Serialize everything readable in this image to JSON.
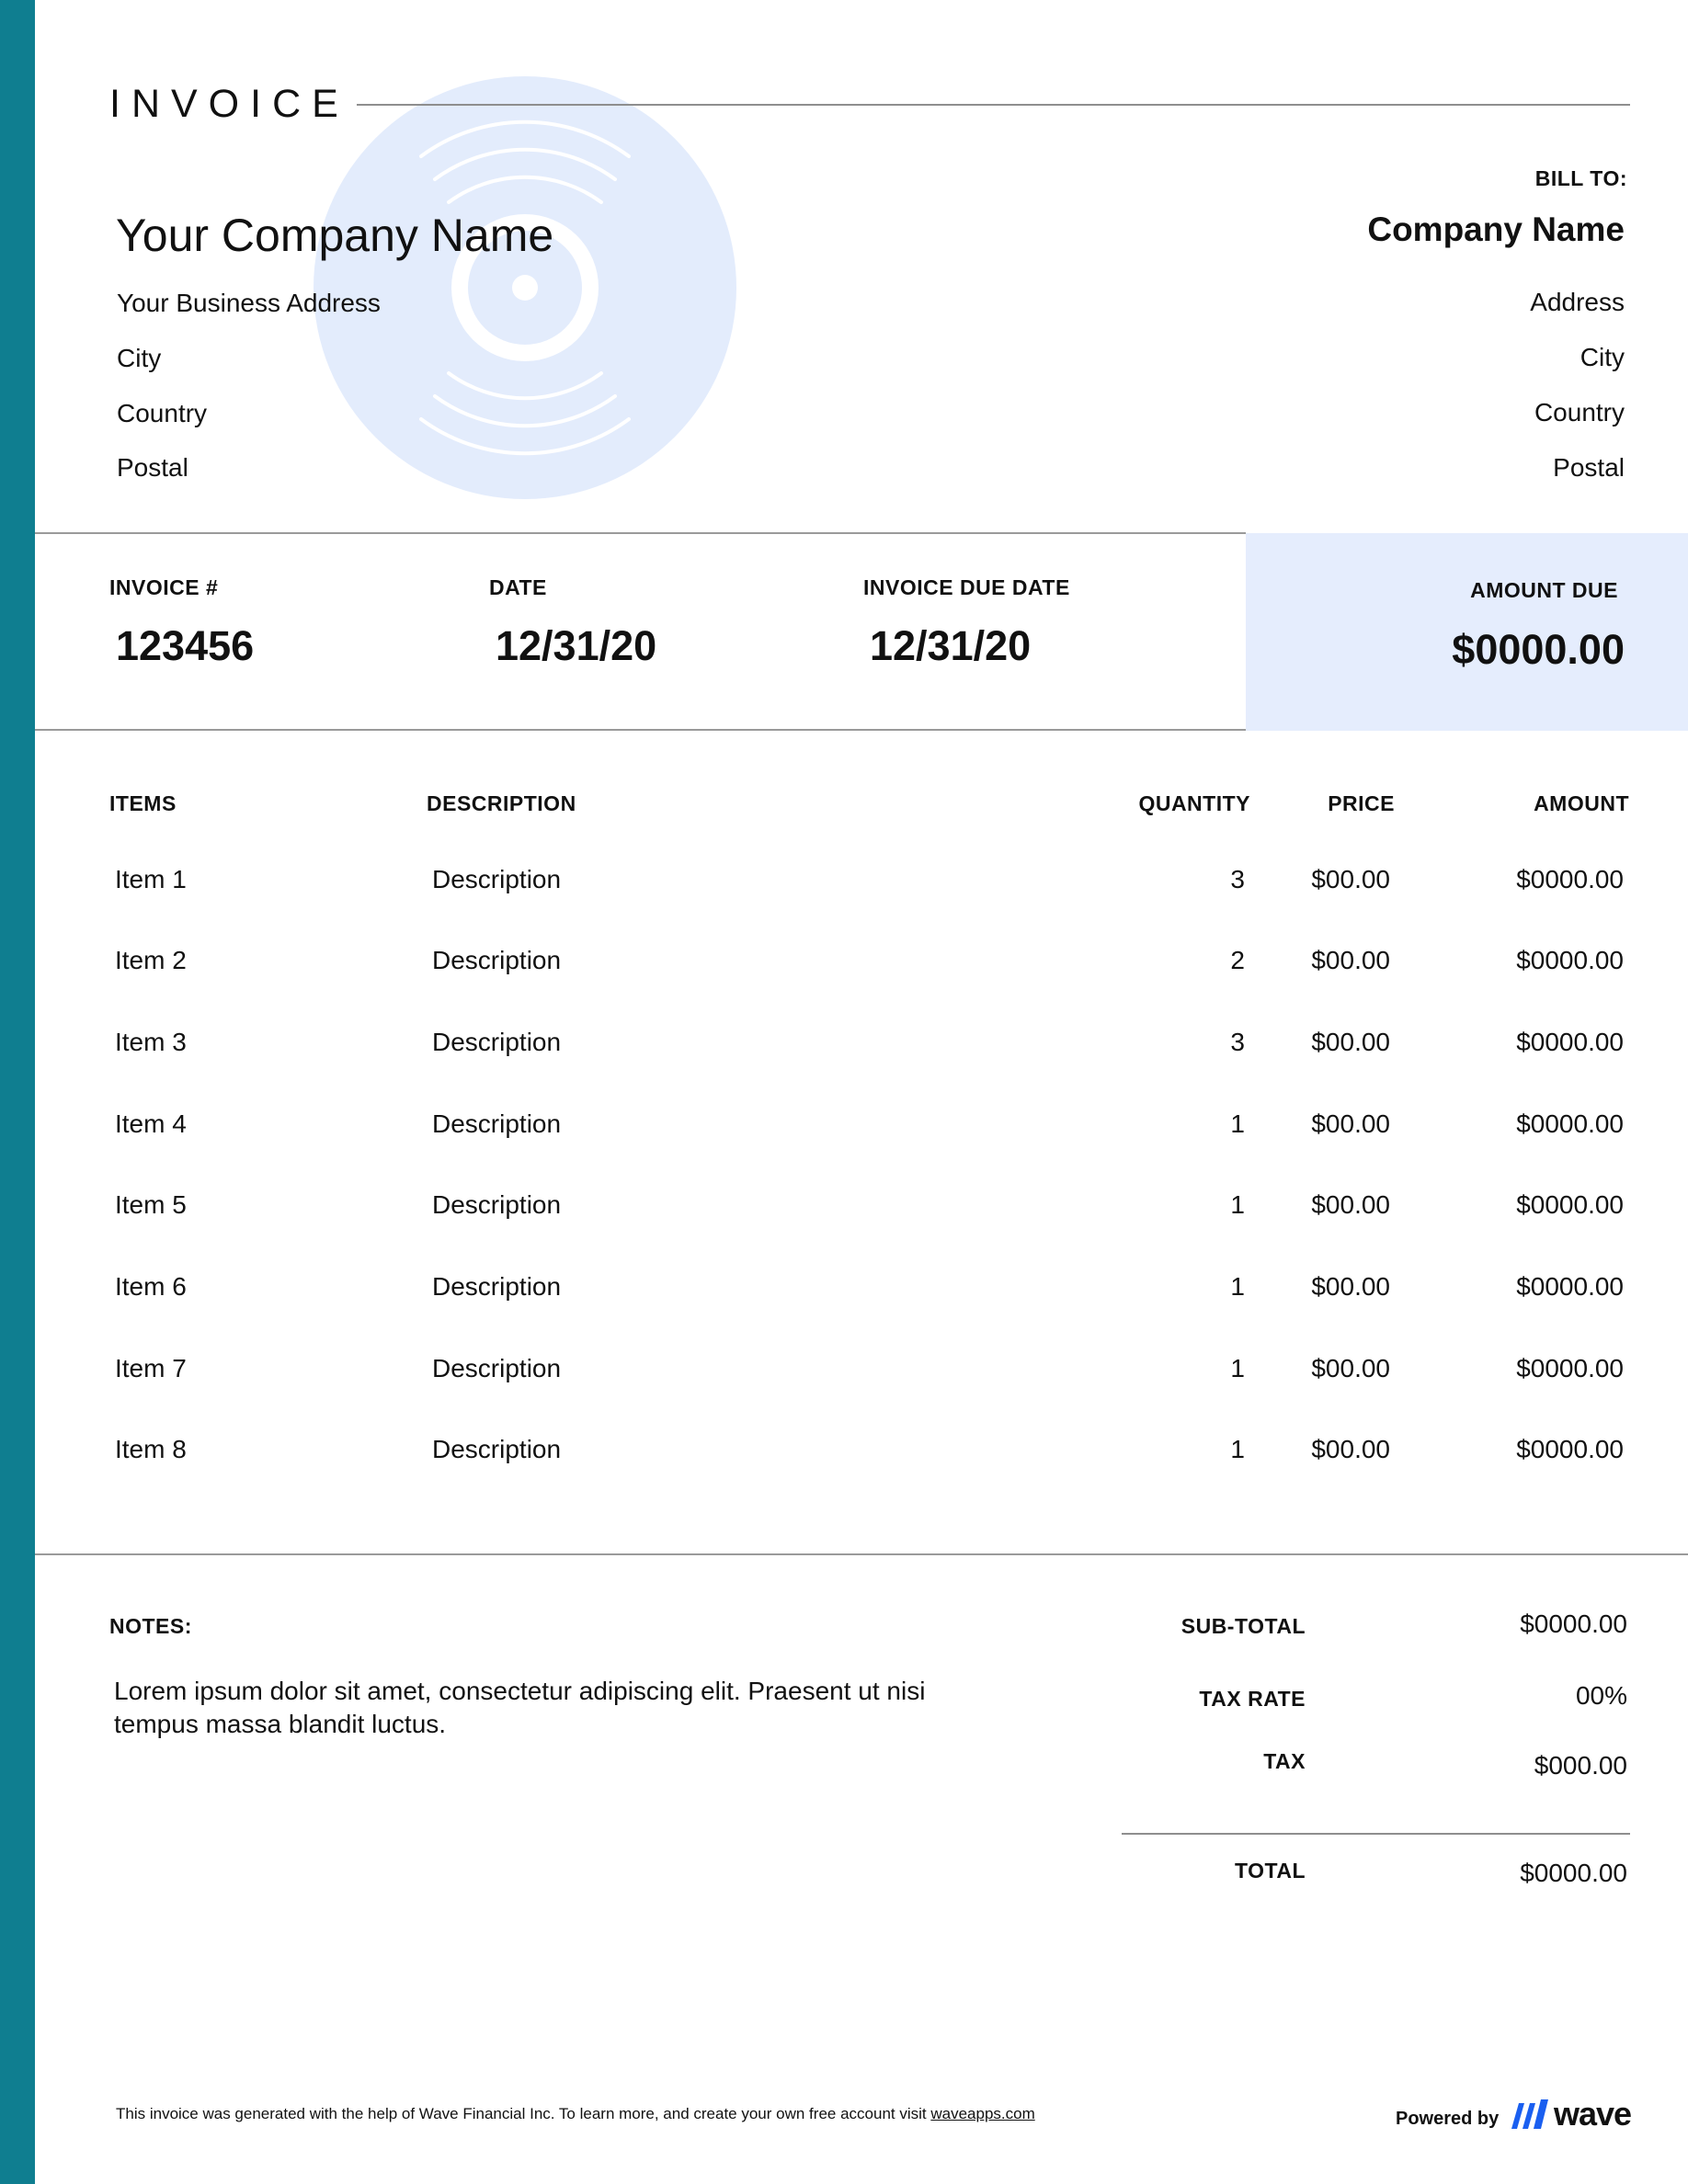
{
  "header": {
    "title": "INVOICE"
  },
  "from": {
    "company": "Your Company Name",
    "lines": [
      "Your Business Address",
      "City",
      "Country",
      "Postal"
    ]
  },
  "bill_to": {
    "label": "BILL TO:",
    "company": "Company Name",
    "lines": [
      "Address",
      "City",
      "Country",
      "Postal"
    ]
  },
  "meta": {
    "invoice_number_label": "INVOICE #",
    "invoice_number": "123456",
    "date_label": "DATE",
    "date": "12/31/20",
    "due_date_label": "INVOICE DUE DATE",
    "due_date": "12/31/20",
    "amount_due_label": "AMOUNT DUE",
    "amount_due": "$0000.00"
  },
  "table": {
    "headers": [
      "ITEMS",
      "DESCRIPTION",
      "QUANTITY",
      "PRICE",
      "AMOUNT"
    ],
    "rows": [
      {
        "item": "Item 1",
        "description": "Description",
        "quantity": "3",
        "price": "$00.00",
        "amount": "$0000.00"
      },
      {
        "item": "Item 2",
        "description": "Description",
        "quantity": "2",
        "price": "$00.00",
        "amount": "$0000.00"
      },
      {
        "item": "Item 3",
        "description": "Description",
        "quantity": "3",
        "price": "$00.00",
        "amount": "$0000.00"
      },
      {
        "item": "Item 4",
        "description": "Description",
        "quantity": "1",
        "price": "$00.00",
        "amount": "$0000.00"
      },
      {
        "item": "Item 5",
        "description": "Description",
        "quantity": "1",
        "price": "$00.00",
        "amount": "$0000.00"
      },
      {
        "item": "Item 6",
        "description": "Description",
        "quantity": "1",
        "price": "$00.00",
        "amount": "$0000.00"
      },
      {
        "item": "Item 7",
        "description": "Description",
        "quantity": "1",
        "price": "$00.00",
        "amount": "$0000.00"
      },
      {
        "item": "Item 8",
        "description": "Description",
        "quantity": "1",
        "price": "$00.00",
        "amount": "$0000.00"
      }
    ]
  },
  "notes": {
    "label": "NOTES:",
    "text": "Lorem ipsum dolor sit amet, consectetur adipiscing elit. Praesent ut nisi tempus massa blandit luctus."
  },
  "totals": {
    "subtotal_label": "SUB-TOTAL",
    "subtotal": "$0000.00",
    "tax_rate_label": "TAX RATE",
    "tax_rate": "00%",
    "tax_label": "TAX",
    "tax": "$000.00",
    "total_label": "TOTAL",
    "total": "$0000.00"
  },
  "footer": {
    "text": "This invoice was generated with the help of Wave Financial Inc. To learn more, and create your own free account visit ",
    "link": "waveapps.com",
    "powered_by": "Powered by",
    "brand": "wave"
  },
  "colors": {
    "sidebar": "#0f7e90",
    "amount_box": "#e5edfd",
    "watermark": "#e3ecfc",
    "wave_logo": "#1a5ff0"
  },
  "icons": {
    "watermark": "vinyl-record-icon",
    "logo": "wave-logo-icon"
  }
}
